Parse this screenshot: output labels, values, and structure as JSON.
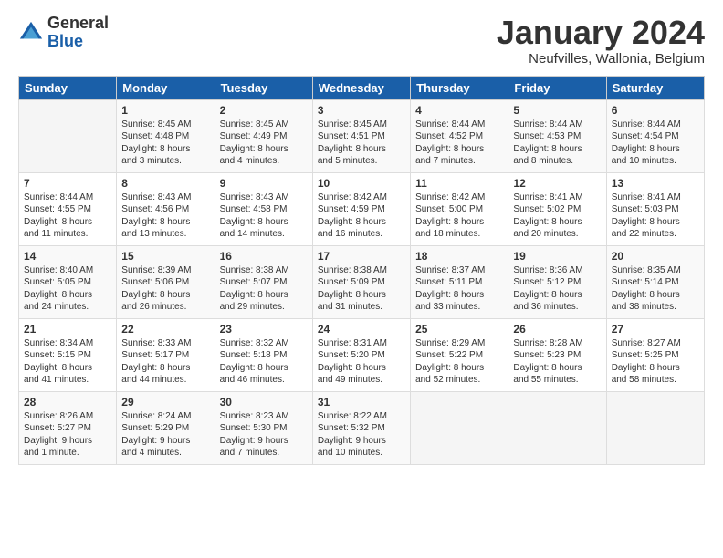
{
  "logo": {
    "general": "General",
    "blue": "Blue"
  },
  "header": {
    "title": "January 2024",
    "subtitle": "Neufvilles, Wallonia, Belgium"
  },
  "days_of_week": [
    "Sunday",
    "Monday",
    "Tuesday",
    "Wednesday",
    "Thursday",
    "Friday",
    "Saturday"
  ],
  "weeks": [
    [
      {
        "num": "",
        "info": ""
      },
      {
        "num": "1",
        "info": "Sunrise: 8:45 AM\nSunset: 4:48 PM\nDaylight: 8 hours\nand 3 minutes."
      },
      {
        "num": "2",
        "info": "Sunrise: 8:45 AM\nSunset: 4:49 PM\nDaylight: 8 hours\nand 4 minutes."
      },
      {
        "num": "3",
        "info": "Sunrise: 8:45 AM\nSunset: 4:51 PM\nDaylight: 8 hours\nand 5 minutes."
      },
      {
        "num": "4",
        "info": "Sunrise: 8:44 AM\nSunset: 4:52 PM\nDaylight: 8 hours\nand 7 minutes."
      },
      {
        "num": "5",
        "info": "Sunrise: 8:44 AM\nSunset: 4:53 PM\nDaylight: 8 hours\nand 8 minutes."
      },
      {
        "num": "6",
        "info": "Sunrise: 8:44 AM\nSunset: 4:54 PM\nDaylight: 8 hours\nand 10 minutes."
      }
    ],
    [
      {
        "num": "7",
        "info": "Sunrise: 8:44 AM\nSunset: 4:55 PM\nDaylight: 8 hours\nand 11 minutes."
      },
      {
        "num": "8",
        "info": "Sunrise: 8:43 AM\nSunset: 4:56 PM\nDaylight: 8 hours\nand 13 minutes."
      },
      {
        "num": "9",
        "info": "Sunrise: 8:43 AM\nSunset: 4:58 PM\nDaylight: 8 hours\nand 14 minutes."
      },
      {
        "num": "10",
        "info": "Sunrise: 8:42 AM\nSunset: 4:59 PM\nDaylight: 8 hours\nand 16 minutes."
      },
      {
        "num": "11",
        "info": "Sunrise: 8:42 AM\nSunset: 5:00 PM\nDaylight: 8 hours\nand 18 minutes."
      },
      {
        "num": "12",
        "info": "Sunrise: 8:41 AM\nSunset: 5:02 PM\nDaylight: 8 hours\nand 20 minutes."
      },
      {
        "num": "13",
        "info": "Sunrise: 8:41 AM\nSunset: 5:03 PM\nDaylight: 8 hours\nand 22 minutes."
      }
    ],
    [
      {
        "num": "14",
        "info": "Sunrise: 8:40 AM\nSunset: 5:05 PM\nDaylight: 8 hours\nand 24 minutes."
      },
      {
        "num": "15",
        "info": "Sunrise: 8:39 AM\nSunset: 5:06 PM\nDaylight: 8 hours\nand 26 minutes."
      },
      {
        "num": "16",
        "info": "Sunrise: 8:38 AM\nSunset: 5:07 PM\nDaylight: 8 hours\nand 29 minutes."
      },
      {
        "num": "17",
        "info": "Sunrise: 8:38 AM\nSunset: 5:09 PM\nDaylight: 8 hours\nand 31 minutes."
      },
      {
        "num": "18",
        "info": "Sunrise: 8:37 AM\nSunset: 5:11 PM\nDaylight: 8 hours\nand 33 minutes."
      },
      {
        "num": "19",
        "info": "Sunrise: 8:36 AM\nSunset: 5:12 PM\nDaylight: 8 hours\nand 36 minutes."
      },
      {
        "num": "20",
        "info": "Sunrise: 8:35 AM\nSunset: 5:14 PM\nDaylight: 8 hours\nand 38 minutes."
      }
    ],
    [
      {
        "num": "21",
        "info": "Sunrise: 8:34 AM\nSunset: 5:15 PM\nDaylight: 8 hours\nand 41 minutes."
      },
      {
        "num": "22",
        "info": "Sunrise: 8:33 AM\nSunset: 5:17 PM\nDaylight: 8 hours\nand 44 minutes."
      },
      {
        "num": "23",
        "info": "Sunrise: 8:32 AM\nSunset: 5:18 PM\nDaylight: 8 hours\nand 46 minutes."
      },
      {
        "num": "24",
        "info": "Sunrise: 8:31 AM\nSunset: 5:20 PM\nDaylight: 8 hours\nand 49 minutes."
      },
      {
        "num": "25",
        "info": "Sunrise: 8:29 AM\nSunset: 5:22 PM\nDaylight: 8 hours\nand 52 minutes."
      },
      {
        "num": "26",
        "info": "Sunrise: 8:28 AM\nSunset: 5:23 PM\nDaylight: 8 hours\nand 55 minutes."
      },
      {
        "num": "27",
        "info": "Sunrise: 8:27 AM\nSunset: 5:25 PM\nDaylight: 8 hours\nand 58 minutes."
      }
    ],
    [
      {
        "num": "28",
        "info": "Sunrise: 8:26 AM\nSunset: 5:27 PM\nDaylight: 9 hours\nand 1 minute."
      },
      {
        "num": "29",
        "info": "Sunrise: 8:24 AM\nSunset: 5:29 PM\nDaylight: 9 hours\nand 4 minutes."
      },
      {
        "num": "30",
        "info": "Sunrise: 8:23 AM\nSunset: 5:30 PM\nDaylight: 9 hours\nand 7 minutes."
      },
      {
        "num": "31",
        "info": "Sunrise: 8:22 AM\nSunset: 5:32 PM\nDaylight: 9 hours\nand 10 minutes."
      },
      {
        "num": "",
        "info": ""
      },
      {
        "num": "",
        "info": ""
      },
      {
        "num": "",
        "info": ""
      }
    ]
  ]
}
